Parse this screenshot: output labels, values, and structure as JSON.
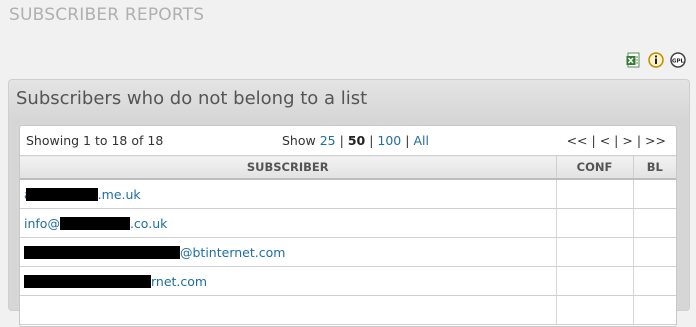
{
  "page": {
    "title": "SUBSCRIBER REPORTS"
  },
  "icons": [
    {
      "name": "excel-export-icon",
      "color": "#2e7d32"
    },
    {
      "name": "info-icon",
      "color": "#e0a000"
    },
    {
      "name": "gpl-icon",
      "color": "#555555"
    }
  ],
  "panel": {
    "title": "Subscribers who do not belong to a list"
  },
  "toolbar": {
    "showing": "Showing 1 to 18 of 18",
    "show_label": "Show",
    "options": [
      "25",
      "50",
      "100",
      "All"
    ],
    "separator": " | ",
    "pager": {
      "first": "<<",
      "prev": "<",
      "next": ">",
      "last": ">>"
    }
  },
  "table": {
    "headers": [
      "SUBSCRIBER",
      "CONF",
      "BL"
    ],
    "rows": [
      {
        "prefix": "a",
        "suffix": ".me.uk"
      },
      {
        "prefix": "info@",
        "suffix": ".co.uk"
      },
      {
        "prefix": "",
        "suffix": "@btinternet.com"
      },
      {
        "prefix": "",
        "suffix": "rnet.com"
      },
      {
        "prefix": "",
        "suffix": ""
      }
    ]
  },
  "colors": {
    "link": "#1f6ea4",
    "title": "#b0b0b0"
  }
}
